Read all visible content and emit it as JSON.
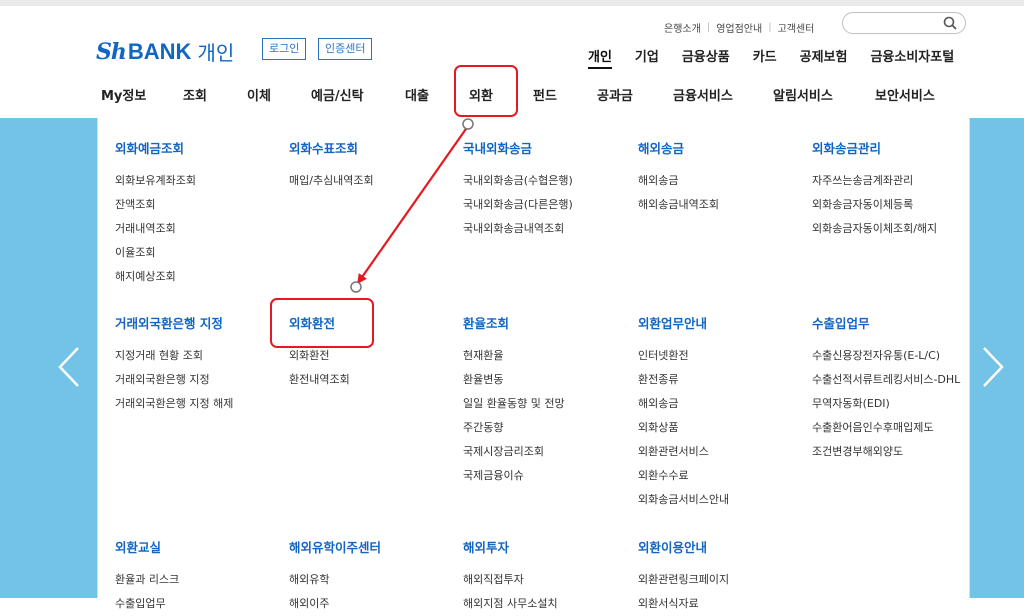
{
  "util": {
    "items": [
      "은행소개",
      "영업점안내",
      "고객센터"
    ]
  },
  "search": {
    "placeholder": "",
    "value": ""
  },
  "brand": {
    "prefix": "Sh",
    "name": "BANK",
    "kind": "개인"
  },
  "auth": {
    "login": "로그인",
    "cert": "인증센터"
  },
  "categories": [
    "개인",
    "기업",
    "금융상품",
    "카드",
    "공제보험",
    "금융소비자포털"
  ],
  "gnb": [
    "My정보",
    "조회",
    "이체",
    "예금/신탁",
    "대출",
    "외환",
    "펀드",
    "공과금",
    "금융서비스",
    "알림서비스",
    "보안서비스"
  ],
  "menu": {
    "c0": {
      "title": "외화예금조회",
      "items": [
        "외화보유계좌조회",
        "잔액조회",
        "거래내역조회",
        "이율조회",
        "해지예상조회"
      ]
    },
    "c1": {
      "title": "외화수표조회",
      "items": [
        "매입/추심내역조회"
      ]
    },
    "c2": {
      "title": "국내외화송금",
      "items": [
        "국내외화송금(수협은행)",
        "국내외화송금(다른은행)",
        "국내외화송금내역조회"
      ]
    },
    "c3": {
      "title": "해외송금",
      "items": [
        "해외송금",
        "해외송금내역조회"
      ]
    },
    "c4": {
      "title": "외화송금관리",
      "items": [
        "자주쓰는송금계좌관리",
        "외화송금자동이체등록",
        "외화송금자동이체조회/해지"
      ]
    },
    "c5": {
      "title": "거래외국환은행 지정",
      "items": [
        "지정거래 현황 조회",
        "거래외국환은행 지정",
        "거래외국환은행 지정 해제"
      ]
    },
    "c6": {
      "title": "외화환전",
      "items": [
        "외화환전",
        "환전내역조회"
      ]
    },
    "c7": {
      "title": "환율조회",
      "items": [
        "현재환율",
        "환율변동",
        "일일 환율동향 및 전망",
        "주간동향",
        "국제시장금리조회",
        "국제금융이슈"
      ]
    },
    "c8": {
      "title": "외환업무안내",
      "items": [
        "인터넷환전",
        "환전종류",
        "해외송금",
        "외화상품",
        "외환관련서비스",
        "외환수수료",
        "외화송금서비스안내"
      ]
    },
    "c9": {
      "title": "수출입업무",
      "items": [
        "수출신용장전자유통(E-L/C)",
        "수출선적서류트레킹서비스-DHL",
        "무역자동화(EDI)",
        "수출환어음인수후매입제도",
        "조건변경부해외양도"
      ]
    },
    "c10": {
      "title": "외환교실",
      "items": [
        "환율과 리스크",
        "수출입업무"
      ]
    },
    "c11": {
      "title": "해외유학이주센터",
      "items": [
        "해외유학",
        "해외이주"
      ]
    },
    "c12": {
      "title": "해외투자",
      "items": [
        "해외직접투자",
        "해외지점 사무소설치"
      ]
    },
    "c13": {
      "title": "외환이용안내",
      "items": [
        "외환관련링크페이지",
        "외환서식자료"
      ]
    }
  }
}
